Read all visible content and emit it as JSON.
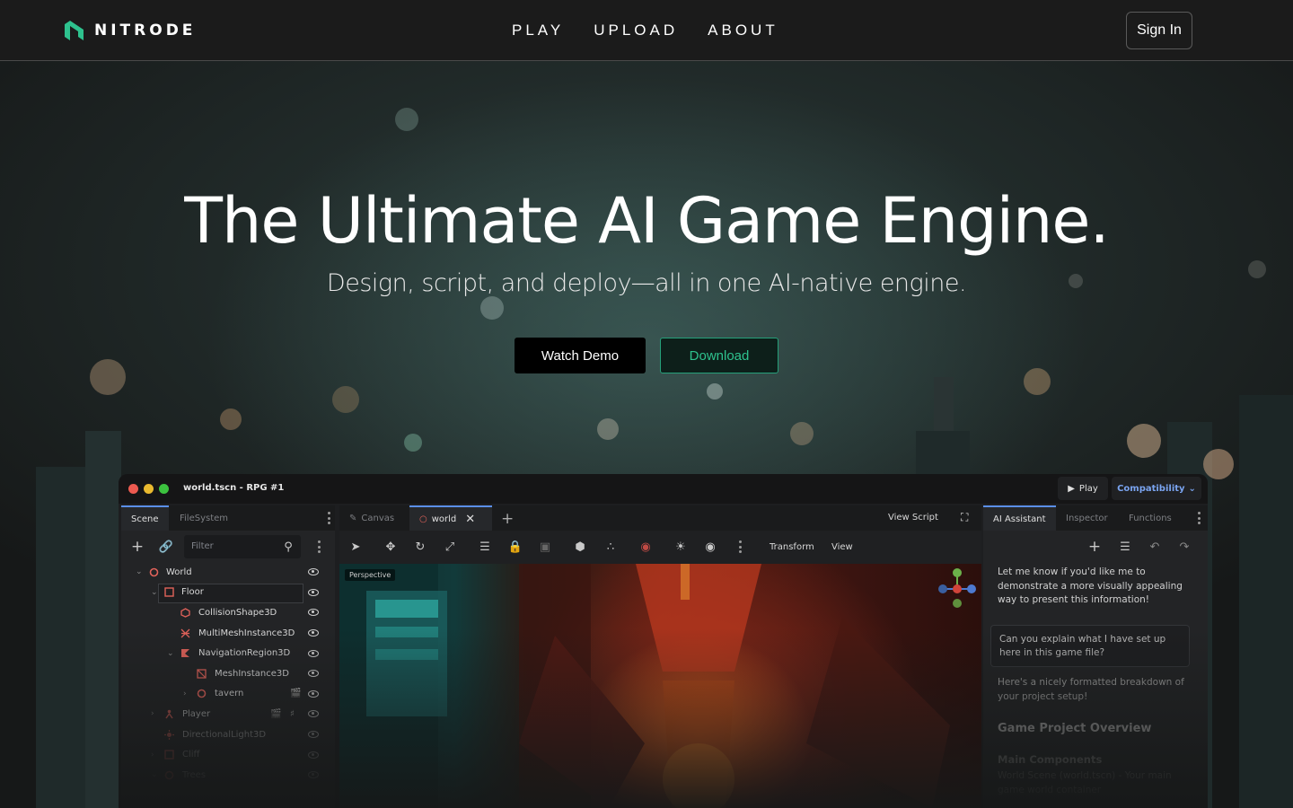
{
  "brand": {
    "name": "NITRODE",
    "accent": "#2ec28e"
  },
  "nav": {
    "items": [
      "PLAY",
      "UPLOAD",
      "ABOUT"
    ],
    "sign_in": "Sign In"
  },
  "hero": {
    "title": "The Ultimate AI Game Engine.",
    "subtitle": "Design, script, and deploy—all in one AI-native engine.",
    "watch_demo": "Watch Demo",
    "download": "Download"
  },
  "editor": {
    "window_title": "world.tscn - RPG #1",
    "play": "Play",
    "compatibility": "Compatibility",
    "left_tabs": [
      "Scene",
      "FileSystem"
    ],
    "filter_placeholder": "Filter",
    "tree": [
      "World",
      "Floor",
      "CollisionShape3D",
      "MultiMeshInstance3D",
      "NavigationRegion3D",
      "MeshInstance3D",
      "tavern",
      "Player",
      "DirectionalLight3D",
      "Cliff",
      "Trees"
    ],
    "mid_tabs": [
      "Canvas",
      "world"
    ],
    "view_script": "View Script",
    "transform": "Transform",
    "view": "View",
    "viewport_label": "Perspective",
    "right_tabs": [
      "AI Assistant",
      "Inspector",
      "Functions"
    ],
    "chat": {
      "msg1": "Let me know if you'd like me to demonstrate a more visually appealing way to present this information!",
      "question": "Can you explain what I have set up here in this game file?",
      "msg2": "Here's a nicely formatted breakdown of your project setup!",
      "heading": "Game Project Overview",
      "subheading": "Main Components",
      "bullet": "World Scene (world.tscn) - Your main game world container"
    }
  }
}
